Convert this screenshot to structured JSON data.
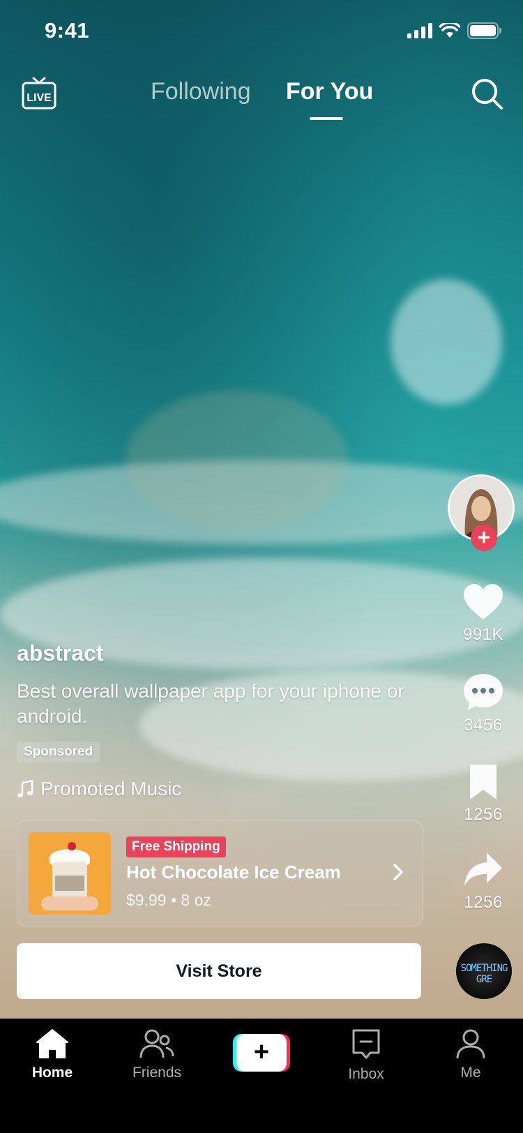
{
  "status_bar": {
    "time": "9:41"
  },
  "top_nav": {
    "live_label": "LIVE",
    "tabs": [
      {
        "label": "Following"
      },
      {
        "label": "For You"
      }
    ],
    "active_tab": "For You"
  },
  "video": {
    "username": "abstract",
    "description": "Best overall wallpaper app for your iphone or android.",
    "sponsored_label": "Sponsored",
    "music_label": "Promoted Music"
  },
  "actions": {
    "likes": "991K",
    "comments": "3456",
    "bookmarks": "1256",
    "shares": "1256"
  },
  "product": {
    "badge": "Free Shipping",
    "title": "Hot Chocolate Ice Cream",
    "meta": "$9.99 • 8 oz"
  },
  "visit_store_label": "Visit Store",
  "music_disc_text": "SOMETHING GRE",
  "bottom_nav": {
    "home": "Home",
    "friends": "Friends",
    "create": "+",
    "inbox": "Inbox",
    "me": "Me"
  },
  "colors": {
    "accent": "#ea4359",
    "create_cyan": "#25f4ee",
    "create_pink": "#fe2c55"
  }
}
